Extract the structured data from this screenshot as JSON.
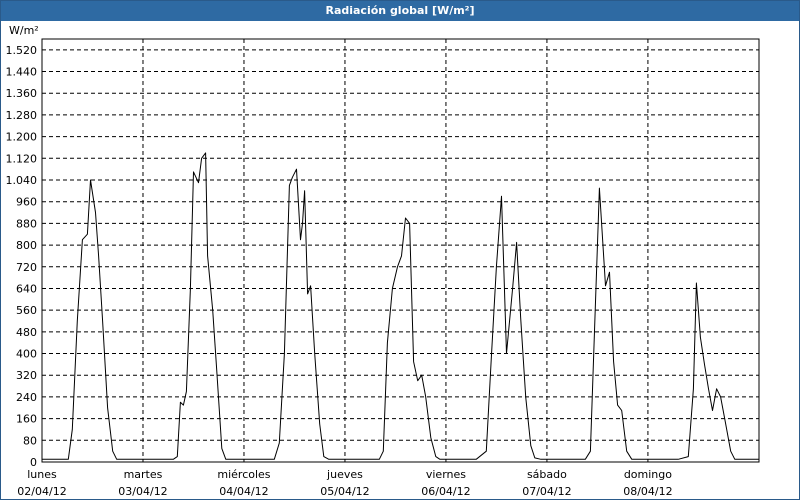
{
  "window": {
    "title": "Radiación global [W/m²]"
  },
  "chart_data": {
    "type": "line",
    "title": "Radiación global [W/m²]",
    "ylabel": "W/m²",
    "xlabel": "",
    "ylim": [
      0,
      1560
    ],
    "yticks": [
      0,
      80,
      160,
      240,
      320,
      400,
      480,
      560,
      640,
      720,
      800,
      880,
      960,
      1040,
      1120,
      1200,
      1280,
      1360,
      1440,
      1520
    ],
    "ytick_labels": [
      "0",
      "80",
      "160",
      "240",
      "320",
      "400",
      "480",
      "560",
      "640",
      "720",
      "800",
      "880",
      "960",
      "1.040",
      "1.120",
      "1.200",
      "1.280",
      "1.360",
      "1.440",
      "1.520"
    ],
    "xlim": [
      0,
      7.1
    ],
    "days": [
      {
        "weekday": "lunes",
        "date": "02/04/12"
      },
      {
        "weekday": "martes",
        "date": "03/04/12"
      },
      {
        "weekday": "miércoles",
        "date": "04/04/12"
      },
      {
        "weekday": "jueves",
        "date": "05/04/12"
      },
      {
        "weekday": "viernes",
        "date": "06/04/12"
      },
      {
        "weekday": "sábado",
        "date": "07/04/12"
      },
      {
        "weekday": "domingo",
        "date": "08/04/12"
      }
    ],
    "grid": true,
    "series": [
      {
        "x": [
          0,
          0.26,
          0.3,
          0.35,
          0.4,
          0.45,
          0.48,
          0.53,
          0.56,
          0.6,
          0.65,
          0.7,
          0.74,
          0.78,
          0.82,
          0.86,
          0.9,
          1.3,
          1.34,
          1.37,
          1.4,
          1.43,
          1.47,
          1.5,
          1.55,
          1.58,
          1.62,
          1.64,
          1.69,
          1.73,
          1.78,
          1.82,
          1.86,
          1.9,
          2.3,
          2.35,
          2.4,
          2.45,
          2.48,
          2.52,
          2.56,
          2.58,
          2.6,
          2.63,
          2.66,
          2.7,
          2.75,
          2.79,
          2.84,
          2.88,
          2.92,
          3.34,
          3.38,
          3.42,
          3.47,
          3.52,
          3.56,
          3.6,
          3.64,
          3.68,
          3.72,
          3.76,
          3.8,
          3.85,
          3.9,
          3.94,
          4.3,
          4.4,
          4.45,
          4.5,
          4.55,
          4.6,
          4.66,
          4.7,
          4.74,
          4.79,
          4.84,
          4.88,
          4.94,
          5.3,
          5.38,
          5.43,
          5.48,
          5.52,
          5.58,
          5.62,
          5.66,
          5.7,
          5.74,
          5.79,
          5.84,
          5.9,
          5.95,
          6.3,
          6.4,
          6.45,
          6.48,
          6.52,
          6.56,
          6.6,
          6.64,
          6.68,
          6.72,
          6.76,
          6.82,
          6.86,
          6.9,
          6.98,
          7.1
        ],
        "y": [
          10,
          10,
          120,
          520,
          820,
          840,
          1040,
          920,
          760,
          520,
          200,
          40,
          10,
          10,
          10,
          10,
          10,
          10,
          20,
          220,
          210,
          260,
          640,
          1070,
          1030,
          1120,
          1140,
          760,
          560,
          340,
          50,
          10,
          10,
          10,
          10,
          70,
          400,
          1020,
          1050,
          1080,
          820,
          880,
          1000,
          620,
          650,
          400,
          140,
          20,
          10,
          10,
          10,
          10,
          40,
          440,
          640,
          720,
          760,
          900,
          880,
          370,
          300,
          320,
          240,
          90,
          20,
          10,
          10,
          40,
          390,
          720,
          980,
          400,
          640,
          810,
          530,
          240,
          60,
          15,
          10,
          10,
          10,
          40,
          580,
          1010,
          650,
          700,
          370,
          210,
          190,
          40,
          10,
          10,
          10,
          10,
          20,
          270,
          660,
          460,
          360,
          270,
          190,
          270,
          240,
          160,
          40,
          10,
          10,
          10,
          10
        ]
      }
    ]
  }
}
